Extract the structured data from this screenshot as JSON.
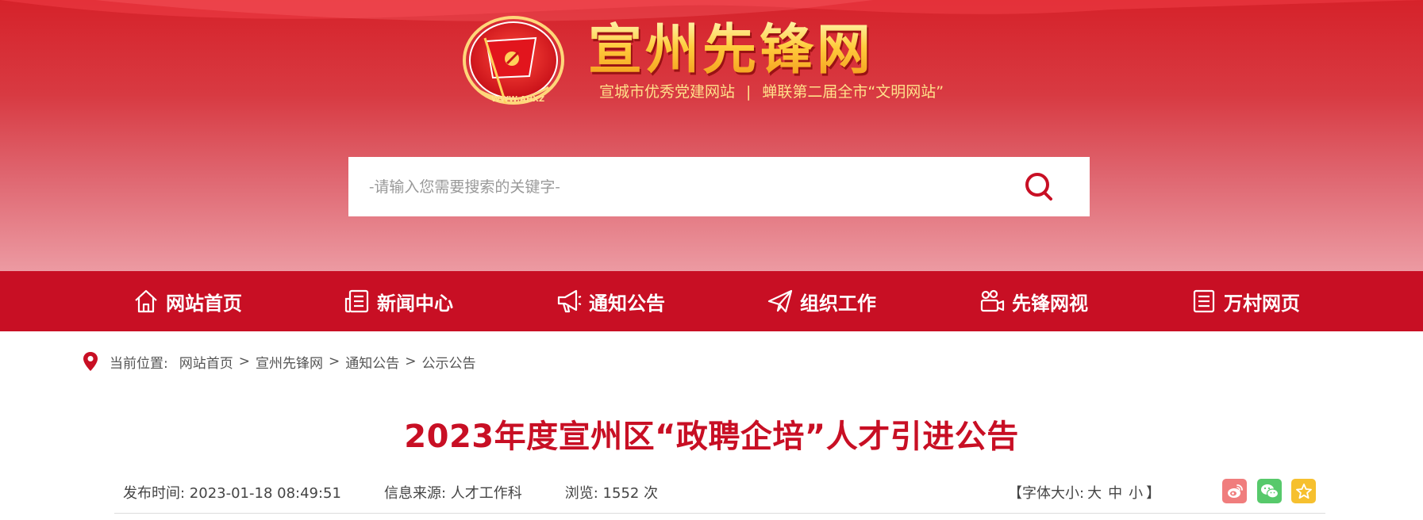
{
  "header": {
    "site_title": "宣州先锋网",
    "emblem_url_text": "WWW.AHXZ",
    "subtitle_left": "宣城市优秀党建网站",
    "subtitle_sep": "|",
    "subtitle_right": "蝉联第二届全市“文明网站”",
    "search_placeholder": "-请输入您需要搜索的关键字-",
    "search_icon": "search-icon"
  },
  "nav": {
    "items": [
      {
        "label": "网站首页",
        "icon": "home-icon"
      },
      {
        "label": "新闻中心",
        "icon": "news-icon"
      },
      {
        "label": "通知公告",
        "icon": "megaphone-icon"
      },
      {
        "label": "组织工作",
        "icon": "paper-plane-icon"
      },
      {
        "label": "先锋网视",
        "icon": "video-icon"
      },
      {
        "label": "万村网页",
        "icon": "document-icon"
      }
    ]
  },
  "breadcrumb": {
    "label": "当前位置:",
    "items": [
      "网站首页",
      "宣州先锋网",
      "通知公告",
      "公示公告"
    ],
    "separator": ">"
  },
  "article": {
    "title": "2023年度宣州区“政聘企培”人才引进公告",
    "publish_time": "发布时间: 2023-01-18 08:49:51",
    "source": "信息来源: 人才工作科",
    "views": "浏览: 1552 次",
    "font_size_open": "【字体大小:",
    "font_large": "大",
    "font_medium": "中",
    "font_small": "小",
    "font_size_close": "】"
  },
  "share": [
    {
      "icon": "weibo-icon",
      "color": "#f07d7d"
    },
    {
      "icon": "wechat-icon",
      "color": "#57c96b"
    },
    {
      "icon": "star-icon",
      "color": "#f6c02f"
    }
  ],
  "colors": {
    "brand_red": "#c80f24",
    "banner_top": "#d6222a",
    "banner_bottom": "#ec9aa2",
    "title_gold": "#ffcc3d"
  }
}
